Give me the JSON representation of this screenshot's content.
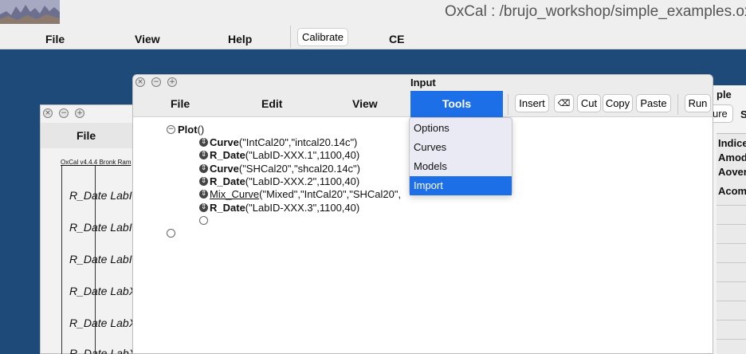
{
  "app": {
    "title": "OxCal : /brujo_workshop/simple_examples.ox",
    "menus": {
      "file": "File",
      "view": "View",
      "help": "Help",
      "ce": "CE"
    },
    "calibrate_label": "Calibrate"
  },
  "plot_window": {
    "menu_file": "File",
    "caption": "OxCal v4.4.4 Bronk Ram",
    "labels": [
      "R_Date LabI",
      "R_Date LabI",
      "R_Date LabI",
      "R_Date LabX",
      "R_Date LabX",
      "R_Date LabX"
    ]
  },
  "right_window": {
    "title_fragment": "ple",
    "button_fragment": "ure",
    "s_fragment": "S",
    "header_lines": [
      "Indice",
      "Amod",
      "Aoverall",
      "Acomb"
    ]
  },
  "input_window": {
    "title": "Input",
    "menus": {
      "file": "File",
      "edit": "Edit",
      "view": "View",
      "tools": "Tools"
    },
    "toolbar": {
      "insert": "Insert",
      "clear": "⌫",
      "cut": "Cut",
      "copy": "Copy",
      "paste": "Paste",
      "run": "Run"
    },
    "code": {
      "root": "Plot",
      "root_args": "()",
      "items": [
        {
          "fn": "Curve",
          "args": "(\"IntCal20\",\"intcal20.14c\")"
        },
        {
          "fn": "R_Date",
          "args": "(\"LabID-XXX.1\",1100,40)"
        },
        {
          "fn": "Curve",
          "args": "(\"SHCal20\",\"shcal20.14c\")"
        },
        {
          "fn": "R_Date",
          "args": "(\"LabID-XXX.2\",1100,40)"
        },
        {
          "fn": "Mix_Curve",
          "args": "(\"Mixed\",\"IntCal20\",\"SHCal20\",",
          "underline": true
        },
        {
          "fn": "R_Date",
          "args": "(\"LabID-XXX.3\",1100,40)"
        }
      ]
    }
  },
  "tools_menu": {
    "items": [
      "Options",
      "Curves",
      "Models",
      "Import"
    ],
    "active": "Import"
  },
  "colors": {
    "accent": "#1d6fe8",
    "desktop": "#1e4a7a"
  }
}
